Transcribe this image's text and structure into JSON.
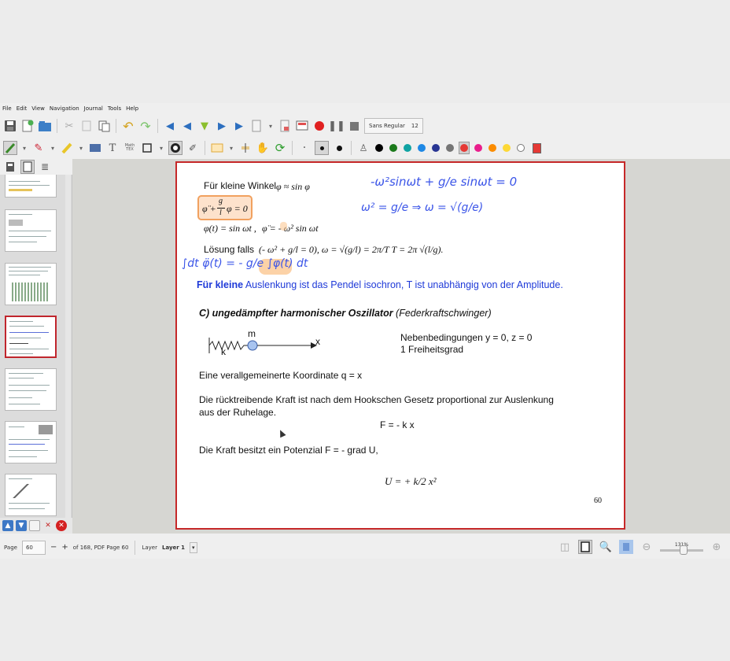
{
  "menu": [
    "File",
    "Edit",
    "View",
    "Navigation",
    "Journal",
    "Tools",
    "Help"
  ],
  "toolbar": {
    "font_name": "Sans Regular",
    "font_size": "12",
    "text_tool_glyph": "T",
    "math_tool_glyph": "Math\nTEX",
    "dot_small": "·"
  },
  "colors": {
    "palette": [
      "#000000",
      "#1b7a1b",
      "#0fa3a3",
      "#1e88e5",
      "#283593",
      "#757575",
      "#e53935",
      "#e91e8c",
      "#fb8c00",
      "#fdd835",
      "#ffffff"
    ],
    "selected_swatch": "#e53935",
    "accent": "#c62828"
  },
  "sidebar": {
    "page_thumbnails": 7,
    "selected_thumbnail_index": 3
  },
  "page": {
    "line1_label": "Für kleine Winkel",
    "line1_formula": "φ ≈ sin φ",
    "eq_box_lhs": "φ̈ +",
    "eq_box_frac_num": "g",
    "eq_box_frac_den": "l",
    "eq_box_rhs": "φ = 0",
    "line3_formula_a": "φ(t) = sin ωt ,",
    "line3_formula_b": "φ̈ = - ω² sin ωt",
    "loesung_label": "Lösung falls",
    "loesung_formula": "(- ω² + g/l = 0),   ω = √(g/l) = 2π/T     T = 2π √(l/g).",
    "isochron_bold": "Für kleine",
    "isochron_rest": " Auslenkung ist das Pendel isochron, T ist unabhängig von der Amplitude.",
    "section_title": "C) ungedämpfter harmonischer Oszillator",
    "section_subtitle": " (Federkraftschwinger)",
    "diagram_mass_label": "m",
    "diagram_spring_label": "k",
    "diagram_axis_label": "x",
    "constraints_line1": "Nebenbedingungen y = 0, z = 0",
    "constraints_line2": "1 Freiheitsgrad",
    "generalized_coord": "Eine verallgemeinerte Koordinate q = x",
    "hooke_line1": "Die rücktreibende Kraft ist nach dem Hookschen Gesetz proportional zur Auslenkung",
    "hooke_line2": "aus der Ruhelage.",
    "force_formula": "F = - k x",
    "potential_text": "Die Kraft besitzt ein Potenzial F = - grad U,",
    "potential_formula": "U = + k/2 x²",
    "page_number": "60"
  },
  "handwriting": {
    "top_eq": "-ω²sinωt + g/e sinωt = 0",
    "omega_eq": "ω² = g/e   ⇒   ω = √(g/e)",
    "integral_eq": "∫dt φ̈(t) = - g/e ∫φ(t) dt"
  },
  "statusbar": {
    "page_label": "Page",
    "page_value": "60",
    "page_minus": "−",
    "page_plus": "+",
    "page_of": "of 168, PDF Page 60",
    "layer_label": "Layer",
    "layer_value": "Layer 1",
    "zoom": "131%",
    "zoom_fraction": 0.55
  }
}
